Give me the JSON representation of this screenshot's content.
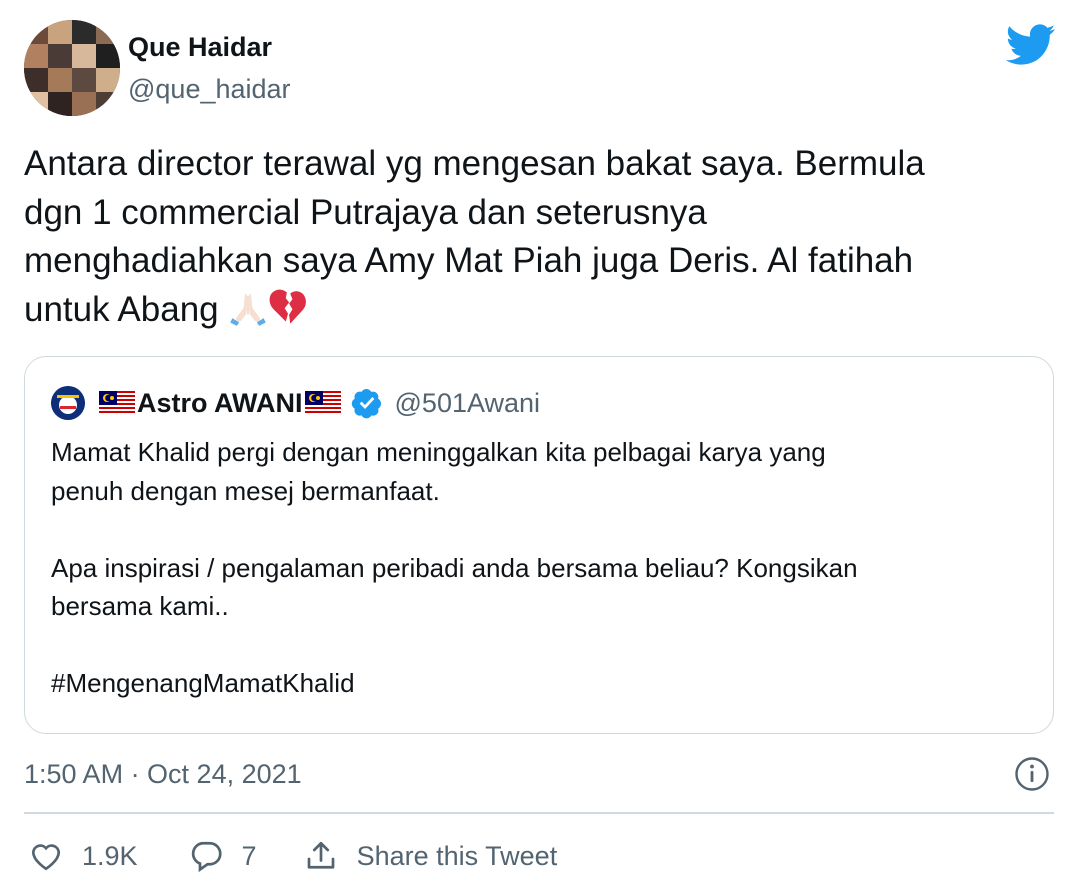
{
  "author": {
    "name": "Que Haidar",
    "handle": "@que_haidar"
  },
  "tweet": {
    "text": "Antara director terawal yg mengesan bakat saya. Bermula\ndgn 1 commercial Putrajaya dan seterusnya\nmenghadiahkan saya Amy Mat Piah juga Deris. Al fatihah\nuntuk Abang ",
    "emojis": [
      "folded-hands-icon",
      "broken-heart-icon"
    ]
  },
  "quoted_tweet": {
    "name": "Astro AWANI",
    "handle": "@501Awani",
    "text": "Mamat Khalid pergi dengan meninggalkan kita pelbagai karya yang\npenuh dengan mesej bermanfaat.\n\nApa inspirasi / pengalaman peribadi anda bersama beliau? Kongsikan\nbersama kami..\n\n#MengenangMamatKhalid"
  },
  "meta": {
    "timestamp": "1:50 AM · Oct 24, 2021"
  },
  "actions": {
    "like_count": "1.9K",
    "reply_count": "7",
    "share_label": "Share this Tweet"
  },
  "colors": {
    "brand_blue": "#1d9bf0",
    "secondary_text": "#536471",
    "border": "#cfd9de",
    "broken_heart": "#dd2e44"
  }
}
